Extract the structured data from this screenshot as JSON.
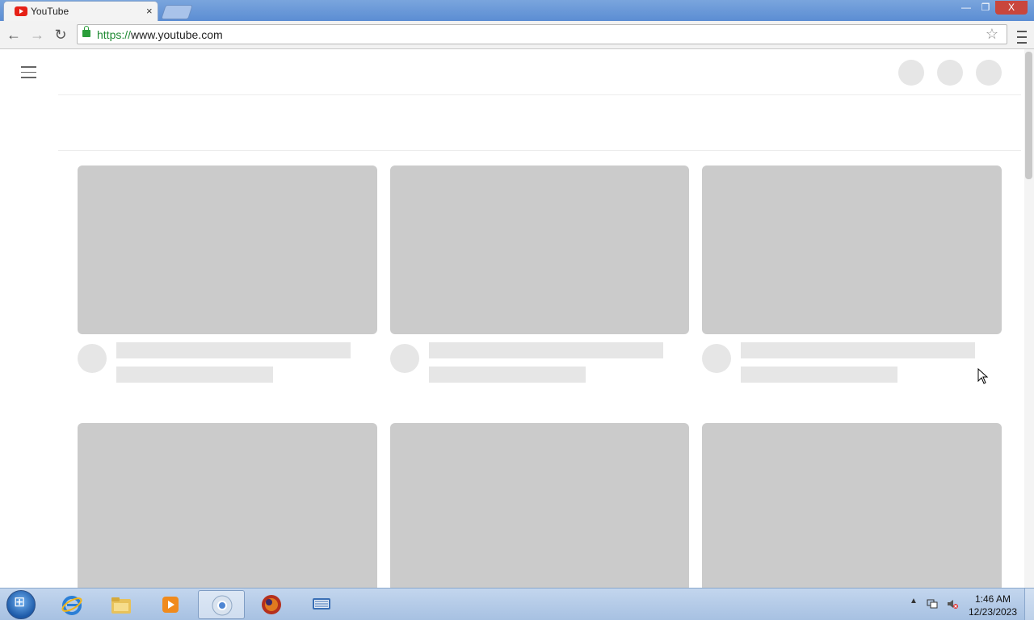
{
  "browser": {
    "tab": {
      "title": "YouTube",
      "favicon": "youtube-favicon",
      "close": "×"
    },
    "url": {
      "scheme": "https://",
      "rest": "www.youtube.com"
    },
    "window_buttons": {
      "minimize": "—",
      "restore": "❐",
      "close": "X"
    },
    "nav": {
      "back": "←",
      "forward": "→",
      "reload": "↻"
    },
    "star": "☆"
  },
  "page": {
    "state": "loading-skeleton",
    "header_circles": 3,
    "card_rows": 2,
    "cards_per_row": 3
  },
  "taskbar": {
    "apps": [
      "internet-explorer",
      "windows-explorer",
      "media-player",
      "chrome",
      "firefox",
      "on-screen-keyboard"
    ],
    "active_app": "chrome",
    "clock": {
      "time": "1:46 AM",
      "date": "12/23/2023"
    },
    "tray_arrow": "▲"
  },
  "colors": {
    "skeleton_thumb": "#cbcbcb",
    "skeleton_light": "#e6e6e6",
    "titlebar": "#5b8dd3",
    "taskbar": "#b5cbe8"
  }
}
